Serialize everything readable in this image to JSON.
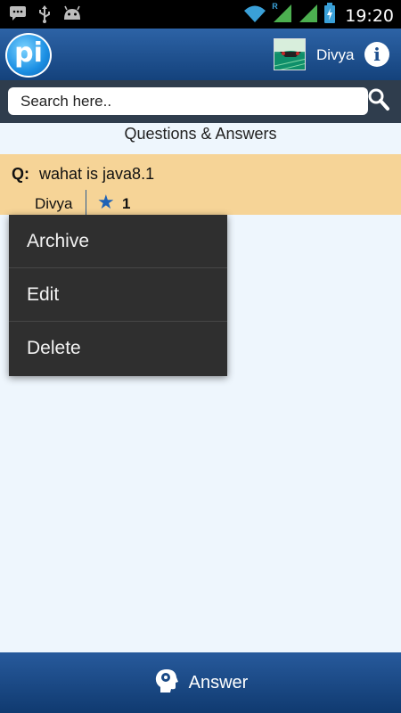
{
  "status_bar": {
    "time": "19:20",
    "network_badge": "R"
  },
  "header": {
    "logo_text": "pi",
    "user_name": "Divya",
    "info_glyph": "i"
  },
  "search": {
    "placeholder": "Search here.."
  },
  "section": {
    "title": "Questions & Answers"
  },
  "question": {
    "prefix": "Q:",
    "text": "wahat is java8.1",
    "author": "Divya",
    "star_count": "1"
  },
  "context_menu": {
    "items": [
      {
        "label": "Archive"
      },
      {
        "label": "Edit"
      },
      {
        "label": "Delete"
      }
    ]
  },
  "bottom_bar": {
    "answer_label": "Answer"
  },
  "colors": {
    "action_bar": "#1f4f8d",
    "search_bar": "#2f3d4d",
    "question_card": "#f6d497",
    "menu_background": "#2f2f2f",
    "star": "#1f62b5",
    "page_background": "#eef6fd"
  },
  "icons": [
    "chat-icon",
    "usb-icon",
    "android-icon",
    "wifi-icon",
    "signal-icon",
    "battery-icon",
    "info-icon",
    "search-icon",
    "star-icon",
    "answer-head-icon"
  ]
}
